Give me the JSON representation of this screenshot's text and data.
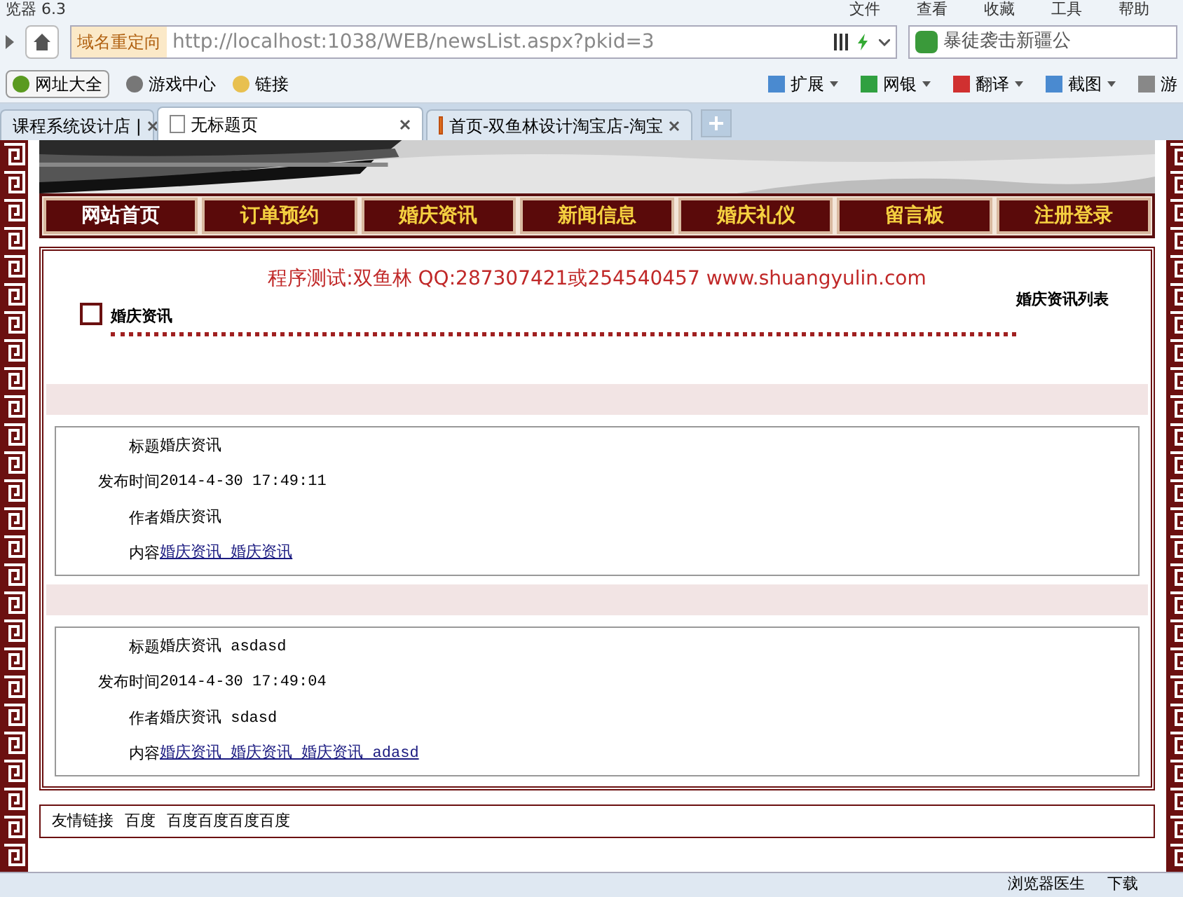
{
  "browser": {
    "title": "览器 6.3",
    "menu": [
      "文件",
      "查看",
      "收藏",
      "工具",
      "帮助"
    ],
    "address_badge": "域名重定向",
    "address": "http://localhost:1038/WEB/newsList.aspx?pkid=3",
    "search": "暴徒袭击新疆公",
    "bookmarks": [
      "网址大全",
      "游戏中心",
      "链接"
    ],
    "tools": [
      "扩展",
      "网银",
      "翻译",
      "截图",
      "游"
    ],
    "tabs": [
      {
        "label": "课程系统设计店 |",
        "selected": false
      },
      {
        "label": "无标题页",
        "selected": true
      },
      {
        "label": "首页-双鱼林设计淘宝店-淘宝",
        "selected": false
      }
    ]
  },
  "nav": [
    {
      "label": "网站首页",
      "selected": true
    },
    {
      "label": "订单预约",
      "selected": false
    },
    {
      "label": "婚庆资讯",
      "selected": false
    },
    {
      "label": "新闻信息",
      "selected": false
    },
    {
      "label": "婚庆礼仪",
      "selected": false
    },
    {
      "label": "留言板",
      "selected": false
    },
    {
      "label": "注册登录",
      "selected": false
    }
  ],
  "notice": "程序测试:双鱼林 QQ:287307421或254540457 www.shuangyulin.com",
  "section": {
    "title": "婚庆资讯",
    "aside": "婚庆资讯列表"
  },
  "news": [
    {
      "title_label": "标题",
      "title": "婚庆资讯",
      "time_label": "发布时间",
      "time": "2014-4-30 17:49:11",
      "author_label": "作者",
      "author": "婚庆资讯",
      "content_label": "内容",
      "content": "婚庆资讯 婚庆资讯"
    },
    {
      "title_label": "标题",
      "title": "婚庆资讯 asdasd",
      "time_label": "发布时间",
      "time": "2014-4-30 17:49:04",
      "author_label": "作者",
      "author": "婚庆资讯 sdasd",
      "content_label": "内容",
      "content": "婚庆资讯 婚庆资讯 婚庆资讯 adasd"
    }
  ],
  "footer": {
    "label": "友情链接",
    "links": [
      "百度",
      "百度百度百度百度"
    ]
  },
  "status_bar": [
    "浏览器医生",
    "下载"
  ]
}
